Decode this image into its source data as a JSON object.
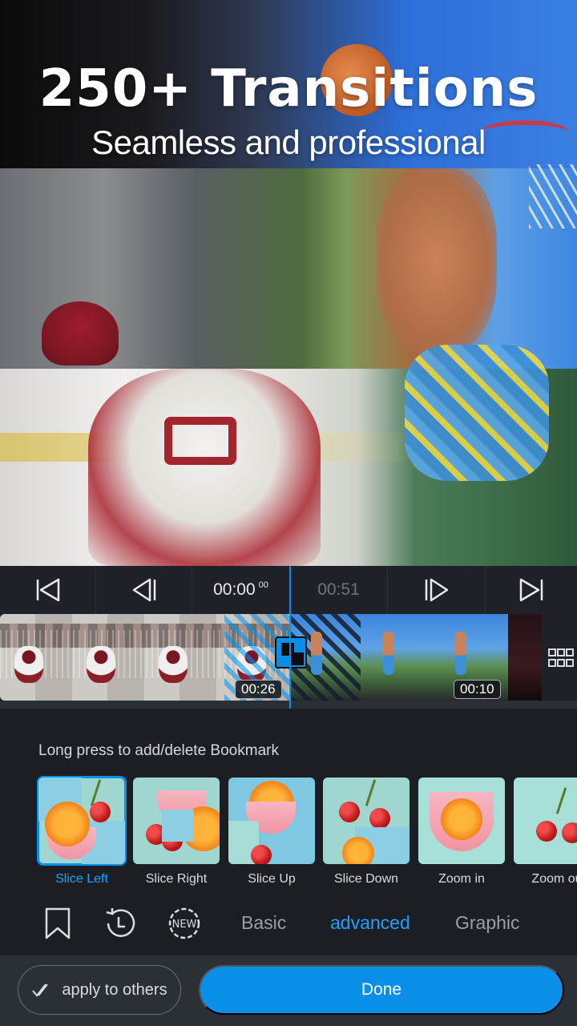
{
  "promo": {
    "headline": "250+ Transitions",
    "subline": "Seamless and professional"
  },
  "transport": {
    "current_time": "00:00",
    "current_frames": "00",
    "total_time": "00:51"
  },
  "timeline": {
    "clip1_duration": "00:26",
    "clip2_duration": "00:10"
  },
  "panel": {
    "hint": "Long press to add/delete Bookmark",
    "transitions": [
      {
        "label": "Slice Left",
        "selected": true
      },
      {
        "label": "Slice Right",
        "selected": false
      },
      {
        "label": "Slice Up",
        "selected": false
      },
      {
        "label": "Slice Down",
        "selected": false
      },
      {
        "label": "Zoom in",
        "selected": false
      },
      {
        "label": "Zoom ou",
        "selected": false
      }
    ]
  },
  "tabs": {
    "new_badge": "NEW",
    "basic": "Basic",
    "advanced": "advanced",
    "graphic": "Graphic",
    "active": "advanced"
  },
  "actions": {
    "apply_label": "apply to others",
    "done_label": "Done"
  },
  "colors": {
    "accent": "#0a8fe8",
    "background": "#1b1e23",
    "selected_text": "#1aa0ff"
  },
  "icons": {
    "skip_start": "skip-to-start-icon",
    "prev_frame": "previous-frame-icon",
    "next_frame": "next-frame-icon",
    "skip_end": "skip-to-end-icon",
    "transition": "transition-icon",
    "grid": "grid-view-icon",
    "bookmark": "bookmark-icon",
    "history": "recent-history-icon",
    "new": "new-badge-icon",
    "double_check": "double-check-icon"
  }
}
